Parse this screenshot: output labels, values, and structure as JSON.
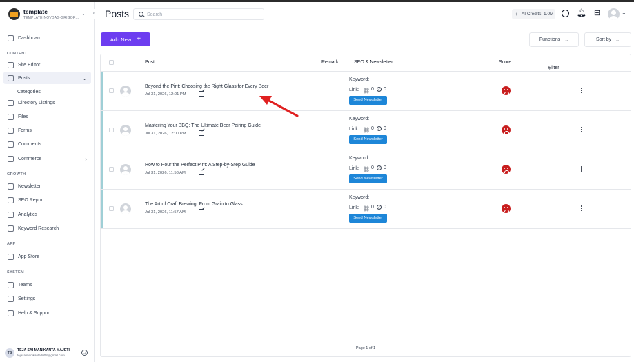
{
  "sidebar": {
    "brand_name": "template",
    "brand_sub": "TEMPLATE-NOVDAG-GRIGOR...",
    "items": {
      "dashboard": "Dashboard",
      "site_editor": "Site Editor",
      "posts": "Posts",
      "categories": "Categories",
      "directory_listings": "Directory Listings",
      "files": "Files",
      "forms": "Forms",
      "comments": "Comments",
      "commerce": "Commerce",
      "newsletter": "Newsletter",
      "seo_report": "SEO Report",
      "analytics": "Analytics",
      "keyword_research": "Keyword Research",
      "app_store": "App Store",
      "teams": "Teams",
      "settings": "Settings",
      "help_support": "Help & Support"
    },
    "sections": {
      "content": "CONTENT",
      "growth": "GROWTH",
      "app": "APP",
      "system": "SYSTEM"
    },
    "user": {
      "initials": "TS",
      "name": "TEJA SAI MANIKANTA MAJETI",
      "email": "tejasaimanikanta2008@gmail.com"
    }
  },
  "header": {
    "title": "Posts",
    "search_placeholder": "Search",
    "credits": "AI Credits: 1.0M"
  },
  "toolbar": {
    "add_new": "Add New",
    "functions": "Functions",
    "sort_by": "Sort by"
  },
  "table": {
    "columns": {
      "post": "Post",
      "remark": "Remark",
      "seo": "SEO & Newsletter",
      "score": "Score",
      "filter": "Filter"
    },
    "keyword_label": "Keyword:",
    "link_label": "Link:",
    "send_label": "Send Newsletter",
    "rows": [
      {
        "title": "Beyond the Pint: Choosing the Right Glass for Every Beer",
        "date": "Jul 31, 2026, 12:01 PM",
        "links": "0",
        "checks": "0"
      },
      {
        "title": "Mastering Your BBQ: The Ultimate Beer Pairing Guide",
        "date": "Jul 31, 2026, 12:00 PM",
        "links": "0",
        "checks": "0"
      },
      {
        "title": "How to Pour the Perfect Pint: A Step-by-Step Guide",
        "date": "Jul 31, 2026, 11:58 AM",
        "links": "0",
        "checks": "0"
      },
      {
        "title": "The Art of Craft Brewing: From Grain to Glass",
        "date": "Jul 31, 2026, 11:57 AM",
        "links": "0",
        "checks": "0"
      }
    ],
    "pager": "Page 1 of 1"
  },
  "colors": {
    "primary": "#6d3df0",
    "newsletter_button": "#1d86d8",
    "score_bad": "#c81e1e",
    "row_accent": "#9fcfd6",
    "annotation_arrow": "#e02020"
  }
}
